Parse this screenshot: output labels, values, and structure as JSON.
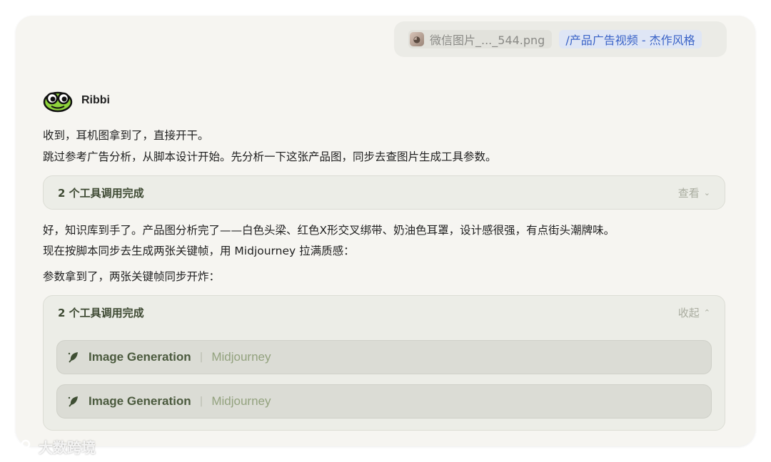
{
  "attachments": {
    "file_name": "微信图片_..._544.png",
    "command": "/产品广告视频 - 杰作风格"
  },
  "author": {
    "name": "Ribbi"
  },
  "messages": {
    "line1": "收到，耳机图拿到了，直接开干。",
    "line2": "跳过参考广告分析，从脚本设计开始。先分析一下这张产品图，同步去查图片生成工具参数。",
    "line3": "好，知识库到手了。产品图分析完了——白色头梁、红色X形交叉绑带、奶油色耳罩，设计感很强，有点街头潮牌味。",
    "line4": "现在按脚本同步去生成两张关键帧，用 Midjourney 拉满质感：",
    "line5": "参数拿到了，两张关键帧同步开炸："
  },
  "tool_blocks": [
    {
      "title": "2 个工具调用完成",
      "toggle": "查看",
      "expanded": false,
      "items": []
    },
    {
      "title": "2 个工具调用完成",
      "toggle": "收起",
      "expanded": true,
      "items": [
        {
          "name": "Image Generation",
          "provider": "Midjourney",
          "icon": "leaf-icon"
        },
        {
          "name": "Image Generation",
          "provider": "Midjourney",
          "icon": "leaf-icon"
        }
      ]
    }
  ],
  "watermark": {
    "text": "大数跨境"
  },
  "colors": {
    "accent": "#3a63c7",
    "tool_text": "#4b5a3e",
    "provider_text": "#93a27e"
  }
}
